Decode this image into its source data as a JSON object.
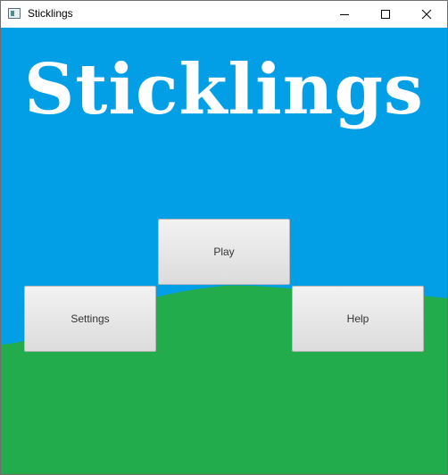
{
  "window": {
    "title": "Sticklings",
    "controls": [
      "minimize-icon",
      "maximize-icon",
      "close-icon"
    ]
  },
  "game": {
    "title": "Sticklings",
    "buttons": {
      "play": "Play",
      "settings": "Settings",
      "help": "Help"
    }
  },
  "colors": {
    "sky": "#039fe6",
    "grass": "#22ac4b",
    "title_text": "#ffffff",
    "button_face": "#e6e6e6"
  }
}
